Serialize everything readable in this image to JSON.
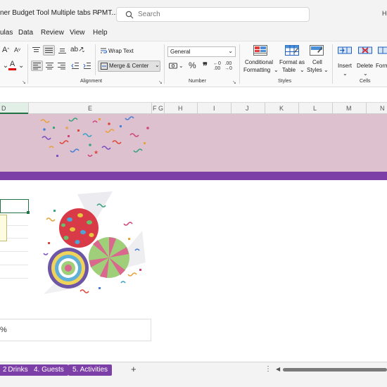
{
  "window": {
    "doc_title": "ner Budget Tool Multiple tabs PPMT...",
    "search_placeholder": "Search",
    "corner_glyph": "H"
  },
  "menu": {
    "items": [
      "ulas",
      "Data",
      "Review",
      "View",
      "Help"
    ]
  },
  "ribbon": {
    "font": {
      "grow": "A",
      "shrink": "A",
      "font_color": "A"
    },
    "alignment": {
      "wrap_text": "Wrap Text",
      "merge_center": "Merge & Center",
      "group_label": "Alignment"
    },
    "number": {
      "format_value": "General",
      "currency": "$",
      "percent": "%",
      "comma": "❞",
      "group_label": "Number"
    },
    "styles": {
      "conditional_line1": "Conditional",
      "conditional_line2": "Formatting",
      "format_table_line1": "Format as",
      "format_table_line2": "Table",
      "cell_styles_line1": "Cell",
      "cell_styles_line2": "Styles",
      "group_label": "Styles"
    },
    "cells": {
      "insert": "Insert",
      "delete": "Delete",
      "format": "Form",
      "group_label": "Cells"
    }
  },
  "columns": [
    "D",
    "E",
    "F",
    "G",
    "H",
    "I",
    "J",
    "K",
    "L",
    "M",
    "N"
  ],
  "sheet": {
    "percent_text": "%",
    "colors": {
      "banner": "#ddc1ce",
      "accent": "#7c3ea7",
      "selection": "#217346"
    }
  },
  "tabs": {
    "items": [
      "Drinks",
      "4. Guests",
      "5. Activities"
    ],
    "add_label": "+",
    "more_label": "⋮"
  }
}
